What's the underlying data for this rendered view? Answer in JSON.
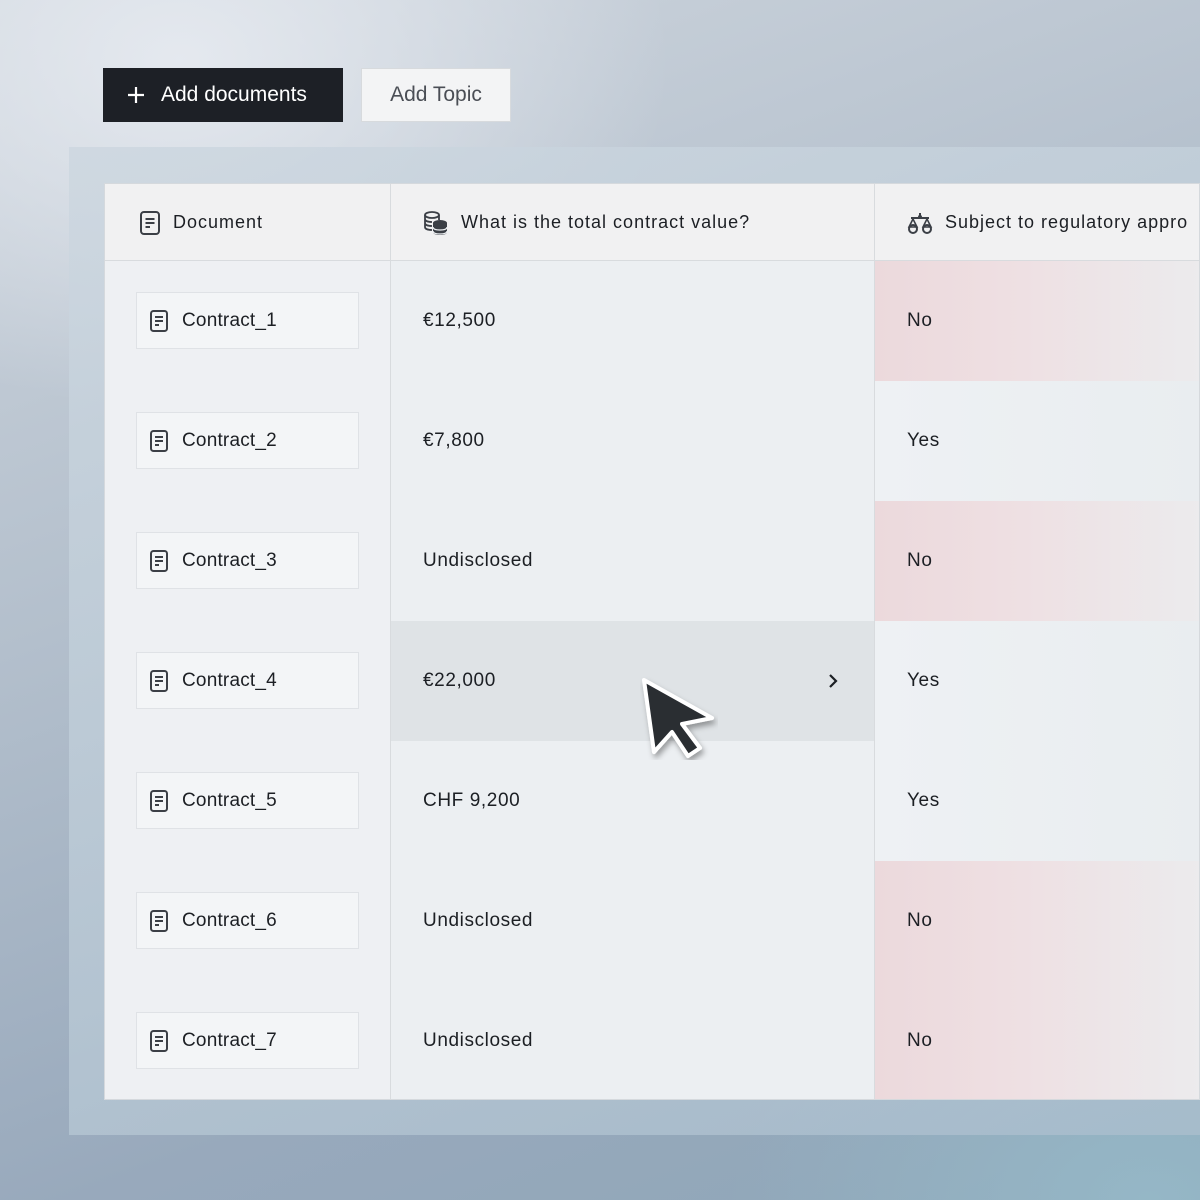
{
  "toolbar": {
    "add_documents_label": "Add documents",
    "add_topic_label": "Add Topic"
  },
  "table": {
    "columns": [
      {
        "label": "Document",
        "icon": "document-icon"
      },
      {
        "label": "What is the total contract value?",
        "icon": "coins-icon"
      },
      {
        "label": "Subject to regulatory appro",
        "icon": "scale-icon"
      }
    ],
    "rows": [
      {
        "document": "Contract_1",
        "value": "€12,500",
        "regulatory": "No"
      },
      {
        "document": "Contract_2",
        "value": "€7,800",
        "regulatory": "Yes"
      },
      {
        "document": "Contract_3",
        "value": "Undisclosed",
        "regulatory": "No"
      },
      {
        "document": "Contract_4",
        "value": "€22,000",
        "regulatory": "Yes"
      },
      {
        "document": "Contract_5",
        "value": "CHF 9,200",
        "regulatory": "Yes"
      },
      {
        "document": "Contract_6",
        "value": "Undisclosed",
        "regulatory": "No"
      },
      {
        "document": "Contract_7",
        "value": "Undisclosed",
        "regulatory": "No"
      }
    ],
    "hovered_row": 4
  },
  "colors": {
    "primary_button": "#1d2026",
    "no_tint": "#ecd9dc",
    "hover_cell": "#dfe3e6"
  }
}
